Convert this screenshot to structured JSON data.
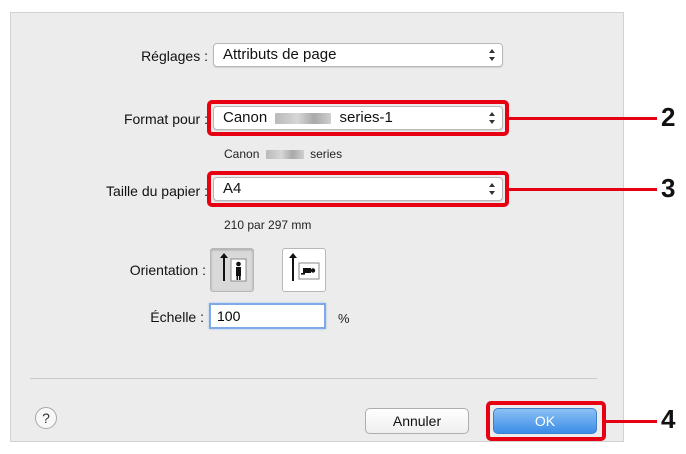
{
  "settings": {
    "label": "Réglages :",
    "value": "Attributs de page"
  },
  "format_for": {
    "label": "Format pour :",
    "value_prefix": "Canon",
    "value_suffix": "series-1",
    "sub_prefix": "Canon",
    "sub_suffix": "series"
  },
  "paper_size": {
    "label": "Taille du papier :",
    "value": "A4",
    "dimensions": "210 par 297 mm"
  },
  "orientation": {
    "label": "Orientation :",
    "options": [
      "portrait-icon",
      "landscape-icon"
    ],
    "selected": "portrait"
  },
  "scale": {
    "label": "Échelle :",
    "value": "100",
    "unit": "%"
  },
  "buttons": {
    "help": "?",
    "cancel": "Annuler",
    "ok": "OK"
  },
  "callouts": [
    "2",
    "3",
    "4"
  ],
  "colors": {
    "callout": "#e60012",
    "ok_button": "#3b8de8",
    "dialog_bg": "#ececec"
  }
}
